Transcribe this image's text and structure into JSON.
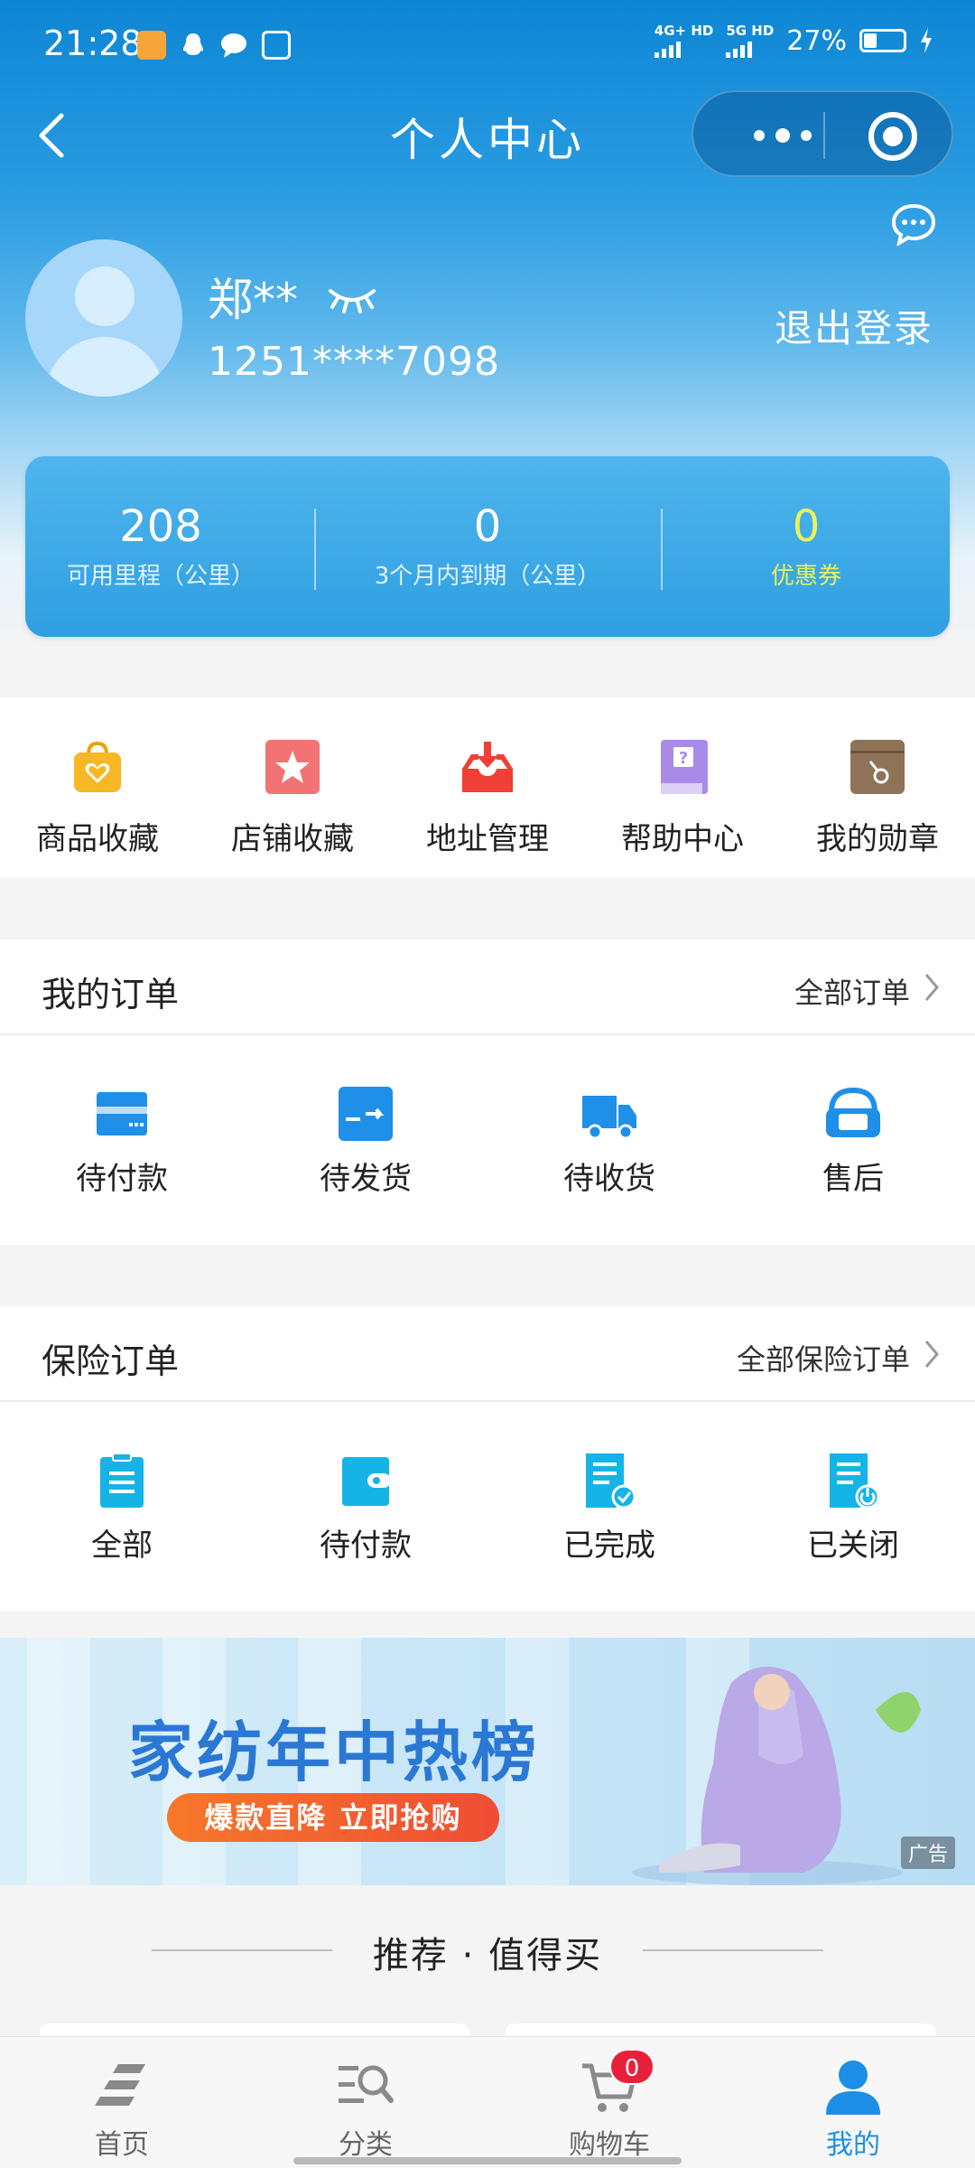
{
  "status_bar": {
    "time": "21:28",
    "network1": "4G+ HD",
    "network2": "5G HD",
    "battery": "27%"
  },
  "nav": {
    "title": "个人中心"
  },
  "profile": {
    "name": "郑**",
    "phone": "1251****7098",
    "logout_label": "退出登录"
  },
  "stats": [
    {
      "value": "208",
      "label": "可用里程（公里）"
    },
    {
      "value": "0",
      "label": "3个月内到期（公里）"
    },
    {
      "value": "0",
      "label": "优惠券"
    }
  ],
  "quick_tools": [
    {
      "label": "商品收藏",
      "icon": "bag-heart-icon"
    },
    {
      "label": "店铺收藏",
      "icon": "star-icon"
    },
    {
      "label": "地址管理",
      "icon": "inbox-download-icon"
    },
    {
      "label": "帮助中心",
      "icon": "help-book-icon"
    },
    {
      "label": "我的勋章",
      "icon": "medal-box-icon"
    }
  ],
  "orders": {
    "title": "我的订单",
    "link": "全部订单",
    "items": [
      {
        "label": "待付款",
        "icon": "card-icon"
      },
      {
        "label": "待发货",
        "icon": "box-arrow-icon"
      },
      {
        "label": "待收货",
        "icon": "truck-icon"
      },
      {
        "label": "售后",
        "icon": "service-icon"
      }
    ]
  },
  "insurance": {
    "title": "保险订单",
    "link": "全部保险订单",
    "items": [
      {
        "label": "全部",
        "icon": "clipboard-icon"
      },
      {
        "label": "待付款",
        "icon": "wallet-icon"
      },
      {
        "label": "已完成",
        "icon": "doc-check-icon"
      },
      {
        "label": "已关闭",
        "icon": "doc-power-icon"
      }
    ]
  },
  "banner": {
    "title": "家纺年中热榜",
    "cta": "爆款直降 立即抢购",
    "ad_label": "广告"
  },
  "recommend": {
    "title": "推荐 · 值得买"
  },
  "tabbar": {
    "items": [
      {
        "label": "首页",
        "icon": "home-icon"
      },
      {
        "label": "分类",
        "icon": "category-search-icon"
      },
      {
        "label": "购物车",
        "icon": "cart-icon"
      },
      {
        "label": "我的",
        "icon": "person-icon"
      }
    ],
    "active": "我的",
    "cart_badge": "0"
  },
  "colors": {
    "primary": "#1c8ee8",
    "coupon": "#ecf05a",
    "badge": "#e8213b"
  }
}
